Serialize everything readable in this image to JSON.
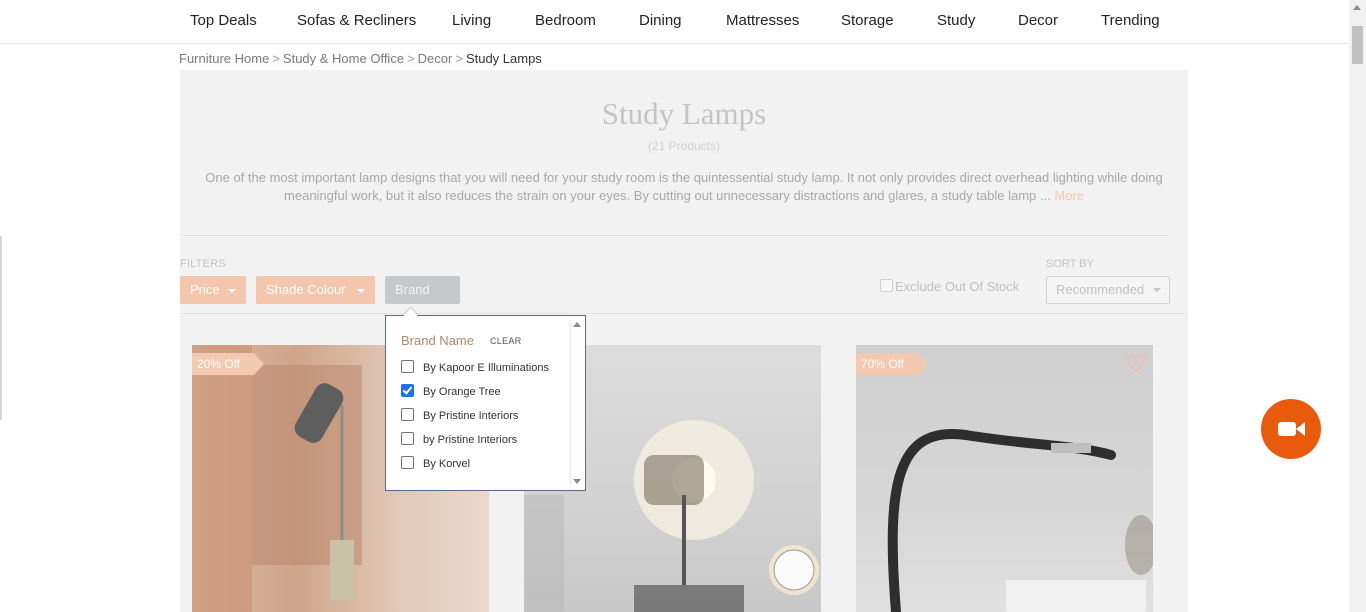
{
  "nav": {
    "items": [
      "Top Deals",
      "Sofas & Recliners",
      "Living",
      "Bedroom",
      "Dining",
      "Mattresses",
      "Storage",
      "Study",
      "Decor",
      "Trending"
    ]
  },
  "breadcrumb": {
    "items": [
      "Furniture Home",
      "Study & Home Office",
      "Decor"
    ],
    "separator": ">",
    "current": "Study Lamps"
  },
  "page": {
    "title": "Study Lamps",
    "count": "(21 Products)",
    "description": "One of the most important lamp designs that you will need for your study room is the quintessential study lamp. It not only provides direct overhead lighting while doing meaningful work, but it also reduces the strain on your eyes. By cutting out unnecessary distractions and glares, a study table lamp ...",
    "more_link": "More"
  },
  "filters": {
    "label": "FILTERS",
    "buttons": [
      "Price",
      "Shade Colour",
      "Brand"
    ],
    "exclude_out_of_stock": "Exclude Out Of Stock",
    "exclude_checked": false,
    "sort_label": "SORT BY",
    "sort_value": "Recommended"
  },
  "brand_dropdown": {
    "heading": "Brand Name",
    "clear": "CLEAR",
    "options": [
      {
        "label": "By Kapoor E Illuminations",
        "checked": false
      },
      {
        "label": "By Orange Tree",
        "checked": true
      },
      {
        "label": "By Pristine Interiors",
        "checked": false
      },
      {
        "label": "by Pristine Interiors",
        "checked": false
      },
      {
        "label": "By Korvel",
        "checked": false
      }
    ]
  },
  "products": [
    {
      "badge": "20% Off"
    },
    {
      "badge": ""
    },
    {
      "badge": "70% Off"
    }
  ],
  "colors": {
    "accent": "#ea5a0c",
    "badge": "#f3c9b0",
    "checkbox_checked": "#1a73e8",
    "brand_heading": "#b08968"
  },
  "icons": {
    "wishlist": "heart-icon",
    "video_call": "video-camera-icon"
  }
}
